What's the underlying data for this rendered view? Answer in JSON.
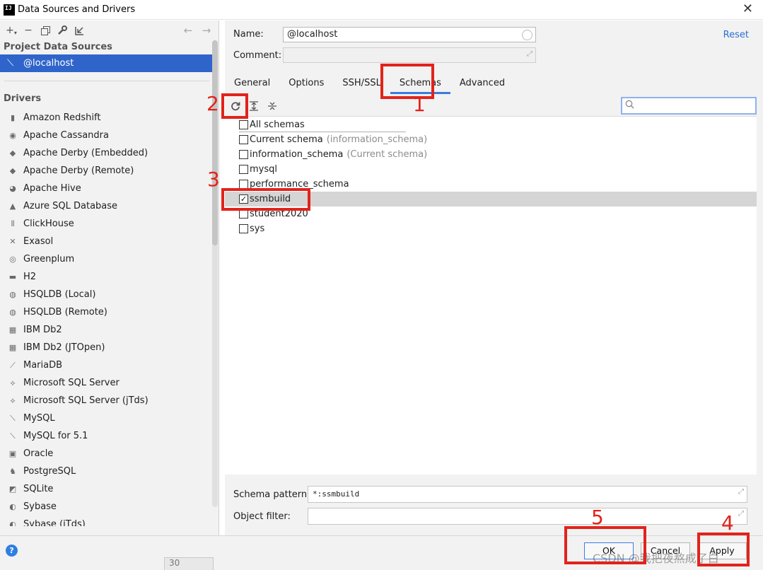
{
  "window": {
    "title": "Data Sources and Drivers",
    "app_icon_text": "IJ"
  },
  "left_toolbar": {
    "icons": [
      "add-icon",
      "remove-icon",
      "duplicate-icon",
      "wrench-icon",
      "import-icon"
    ],
    "add": "+",
    "remove": "−"
  },
  "project_section": {
    "title": "Project Data Sources",
    "items": [
      {
        "label": "@localhost"
      }
    ]
  },
  "drivers_section": {
    "title": "Drivers",
    "items": [
      {
        "label": "Amazon Redshift",
        "icon": "▮"
      },
      {
        "label": "Apache Cassandra",
        "icon": "◉"
      },
      {
        "label": "Apache Derby (Embedded)",
        "icon": "◆"
      },
      {
        "label": "Apache Derby (Remote)",
        "icon": "◆"
      },
      {
        "label": "Apache Hive",
        "icon": "◕"
      },
      {
        "label": "Azure SQL Database",
        "icon": "▲"
      },
      {
        "label": "ClickHouse",
        "icon": "⦀"
      },
      {
        "label": "Exasol",
        "icon": "✕"
      },
      {
        "label": "Greenplum",
        "icon": "◎"
      },
      {
        "label": "H2",
        "icon": "▬"
      },
      {
        "label": "HSQLDB (Local)",
        "icon": "◍"
      },
      {
        "label": "HSQLDB (Remote)",
        "icon": "◍"
      },
      {
        "label": "IBM Db2",
        "icon": "▦"
      },
      {
        "label": "IBM Db2 (JTOpen)",
        "icon": "▦"
      },
      {
        "label": "MariaDB",
        "icon": "⟋"
      },
      {
        "label": "Microsoft SQL Server",
        "icon": "⟡"
      },
      {
        "label": "Microsoft SQL Server (jTds)",
        "icon": "⟡"
      },
      {
        "label": "MySQL",
        "icon": "⟍"
      },
      {
        "label": "MySQL for 5.1",
        "icon": "⟍"
      },
      {
        "label": "Oracle",
        "icon": "▣"
      },
      {
        "label": "PostgreSQL",
        "icon": "♞"
      },
      {
        "label": "SQLite",
        "icon": "◩"
      },
      {
        "label": "Sybase",
        "icon": "◐"
      },
      {
        "label": "Sybase (jTds)",
        "icon": "◐"
      }
    ]
  },
  "form": {
    "name_label": "Name:",
    "name_value": "@localhost",
    "comment_label": "Comment:",
    "comment_value": "",
    "reset_label": "Reset"
  },
  "tabs": [
    {
      "label": "General",
      "active": false
    },
    {
      "label": "Options",
      "active": false
    },
    {
      "label": "SSH/SSL",
      "active": false
    },
    {
      "label": "Schemas",
      "active": true
    },
    {
      "label": "Advanced",
      "active": false
    }
  ],
  "schema_toolbar": {
    "icons": [
      "refresh-icon",
      "expand-all-icon",
      "collapse-all-icon"
    ],
    "search_value": ""
  },
  "schemas": [
    {
      "name": "All schemas",
      "note": "",
      "checked": false,
      "selected": false
    },
    {
      "name": "Current schema",
      "note": "(information_schema)",
      "checked": false,
      "selected": false
    },
    {
      "name": "information_schema",
      "note": "(Current schema)",
      "checked": false,
      "selected": false
    },
    {
      "name": "mysql",
      "note": "",
      "checked": false,
      "selected": false
    },
    {
      "name": "performance_schema",
      "note": "",
      "checked": false,
      "selected": false
    },
    {
      "name": "ssmbuild",
      "note": "",
      "checked": true,
      "selected": true
    },
    {
      "name": "student2020",
      "note": "",
      "checked": false,
      "selected": false
    },
    {
      "name": "sys",
      "note": "",
      "checked": false,
      "selected": false
    }
  ],
  "patterns": {
    "schema_label": "Schema pattern:",
    "schema_value": "*:ssmbuild",
    "object_label": "Object filter:",
    "object_value": ""
  },
  "buttons": {
    "ok": "OK",
    "cancel": "Cancel",
    "apply": "Apply",
    "help": "?"
  },
  "background_tab": "30",
  "watermark": "CSDN @我把夜熬成了白_",
  "annotations": {
    "color": "#e2231a",
    "labels": [
      "1",
      "2",
      "3",
      "4",
      "5"
    ]
  },
  "colors": {
    "selection": "#2f65ca",
    "accent": "#3d7ae0",
    "link": "#2a6ed3"
  }
}
